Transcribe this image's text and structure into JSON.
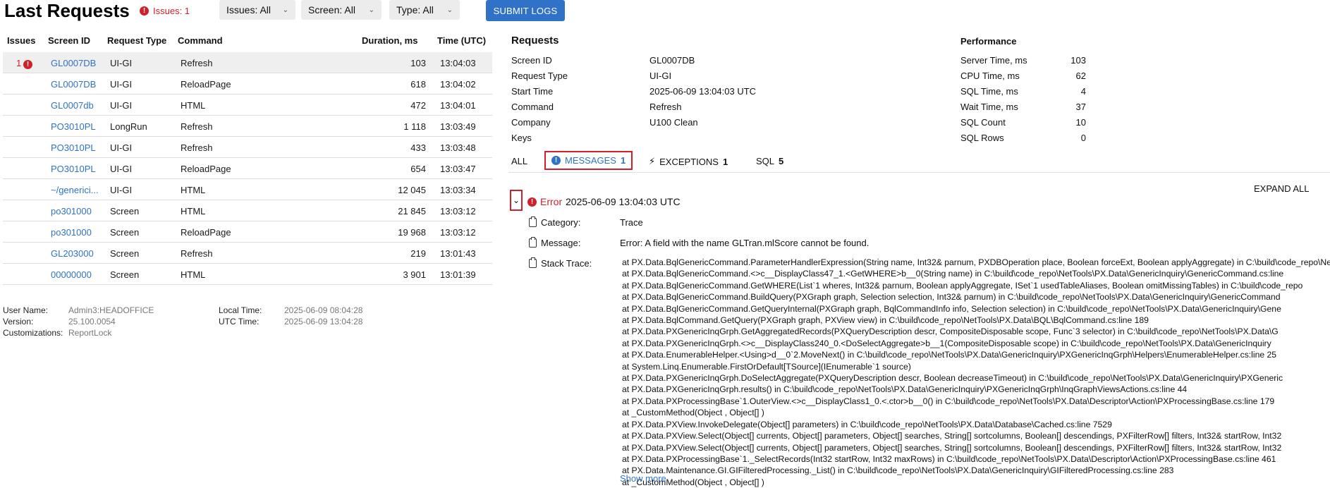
{
  "header": {
    "title": "Last Requests",
    "issues_label": "Issues: 1",
    "filters": [
      {
        "label": "Issues: All"
      },
      {
        "label": "Screen: All"
      },
      {
        "label": "Type: All"
      }
    ],
    "submit_label": "SUBMIT LOGS"
  },
  "table": {
    "columns": [
      "Issues",
      "Screen ID",
      "Request Type",
      "Command",
      "Duration, ms",
      "Time (UTC)"
    ],
    "rows": [
      {
        "issues": "1",
        "screen": "GL0007DB",
        "type": "UI-GI",
        "command": "Refresh",
        "duration": "103",
        "time": "13:04:03"
      },
      {
        "issues": "",
        "screen": "GL0007DB",
        "type": "UI-GI",
        "command": "ReloadPage",
        "duration": "618",
        "time": "13:04:02"
      },
      {
        "issues": "",
        "screen": "GL0007db",
        "type": "UI-GI",
        "command": "HTML",
        "duration": "472",
        "time": "13:04:01"
      },
      {
        "issues": "",
        "screen": "PO3010PL",
        "type": "LongRun",
        "command": "Refresh",
        "duration": "1 118",
        "time": "13:03:49"
      },
      {
        "issues": "",
        "screen": "PO3010PL",
        "type": "UI-GI",
        "command": "Refresh",
        "duration": "433",
        "time": "13:03:48"
      },
      {
        "issues": "",
        "screen": "PO3010PL",
        "type": "UI-GI",
        "command": "ReloadPage",
        "duration": "654",
        "time": "13:03:47"
      },
      {
        "issues": "",
        "screen": "~/generici...",
        "type": "UI-GI",
        "command": "HTML",
        "duration": "12 045",
        "time": "13:03:34"
      },
      {
        "issues": "",
        "screen": "po301000",
        "type": "Screen",
        "command": "HTML",
        "duration": "21 845",
        "time": "13:03:12"
      },
      {
        "issues": "",
        "screen": "po301000",
        "type": "Screen",
        "command": "ReloadPage",
        "duration": "19 968",
        "time": "13:03:12"
      },
      {
        "issues": "",
        "screen": "GL203000",
        "type": "Screen",
        "command": "Refresh",
        "duration": "219",
        "time": "13:01:43"
      },
      {
        "issues": "",
        "screen": "00000000",
        "type": "Screen",
        "command": "HTML",
        "duration": "3 901",
        "time": "13:01:39"
      }
    ]
  },
  "footer": {
    "user_name_label": "User Name:",
    "user_name": "Admin3:HEADOFFICE",
    "version_label": "Version:",
    "version": "25.100.0054",
    "customizations_label": "Customizations:",
    "customizations": "ReportLock",
    "local_time_label": "Local Time:",
    "local_time": "2025-06-09 08:04:28",
    "utc_time_label": "UTC Time:",
    "utc_time": "2025-06-09 13:04:28"
  },
  "requests": {
    "title": "Requests",
    "fields": [
      {
        "label": "Screen ID",
        "value": "GL0007DB"
      },
      {
        "label": "Request Type",
        "value": "UI-GI"
      },
      {
        "label": "Start Time",
        "value": "2025-06-09 13:04:03 UTC"
      },
      {
        "label": "Command",
        "value": "Refresh"
      },
      {
        "label": "Company",
        "value": "U100 Clean"
      },
      {
        "label": "Keys",
        "value": ""
      }
    ]
  },
  "performance": {
    "title": "Performance",
    "fields": [
      {
        "label": "Server Time, ms",
        "value": "103"
      },
      {
        "label": "CPU Time, ms",
        "value": "62"
      },
      {
        "label": "SQL Time, ms",
        "value": "4"
      },
      {
        "label": "Wait Time, ms",
        "value": "37"
      },
      {
        "label": "SQL Count",
        "value": "10"
      },
      {
        "label": "SQL Rows",
        "value": "0"
      }
    ]
  },
  "tabs": {
    "all": "ALL",
    "messages": "MESSAGES",
    "messages_count": "1",
    "exceptions": "EXCEPTIONS",
    "exceptions_count": "1",
    "sql": "SQL",
    "sql_count": "5"
  },
  "detail": {
    "expand_all": "EXPAND ALL",
    "error_label": "Error",
    "error_time": "2025-06-09 13:04:03 UTC",
    "category_label": "Category:",
    "category": "Trace",
    "message_label": "Message:",
    "message": "Error: A field with the name GLTran.mlScore cannot be found.",
    "stack_label": "Stack Trace:",
    "stack_lines": [
      "at PX.Data.BqlGenericCommand.ParameterHandlerExpression(String name, Int32& parnum, PXDBOperation place, Boolean forceExt, Boolean applyAggregate) in C:\\build\\code_repo\\NetTools\\PX.Data\\GenericInquiry\\GenericCommand.cs:line",
      "at PX.Data.BqlGenericCommand.<>c__DisplayClass47_1.<GetWHERE>b__0(String name) in C:\\build\\code_repo\\NetTools\\PX.Data\\GenericInquiry\\GenericCommand.cs:line",
      "at PX.Data.BqlGenericCommand.GetWHERE(List`1 wheres, Int32& parnum, Boolean applyAggregate, ISet`1 usedTableAliases, Boolean omitMissingTables) in C:\\build\\code_repo",
      "at PX.Data.BqlGenericCommand.BuildQuery(PXGraph graph, Selection selection, Int32& parnum) in C:\\build\\code_repo\\NetTools\\PX.Data\\GenericInquiry\\GenericCommand",
      "at PX.Data.BqlGenericCommand.GetQueryInternal(PXGraph graph, BqlCommandInfo info, Selection selection) in C:\\build\\code_repo\\NetTools\\PX.Data\\GenericInquiry\\Gene",
      "at PX.Data.BqlCommand.GetQuery(PXGraph graph, PXView view) in C:\\build\\code_repo\\NetTools\\PX.Data\\BQL\\BqlCommand.cs:line 189",
      "at PX.Data.PXGenericInqGrph.GetAggregatedRecords(PXQueryDescription descr, CompositeDisposable scope, Func`3 selector) in C:\\build\\code_repo\\NetTools\\PX.Data\\G",
      "at PX.Data.PXGenericInqGrph.<>c__DisplayClass240_0.<DoSelectAggregate>b__1(CompositeDisposable scope) in C:\\build\\code_repo\\NetTools\\PX.Data\\GenericInquiry",
      "at PX.Data.EnumerableHelper.<Using>d__0`2.MoveNext() in C:\\build\\code_repo\\NetTools\\PX.Data\\GenericInquiry\\PXGenericInqGrph\\Helpers\\EnumerableHelper.cs:line 25",
      "at System.Linq.Enumerable.FirstOrDefault[TSource](IEnumerable`1 source)",
      "at PX.Data.PXGenericInqGrph.DoSelectAggregate(PXQueryDescription descr, Boolean decreaseTimeout) in C:\\build\\code_repo\\NetTools\\PX.Data\\GenericInquiry\\PXGeneric",
      "at PX.Data.PXGenericInqGrph.results() in C:\\build\\code_repo\\NetTools\\PX.Data\\GenericInquiry\\PXGenericInqGrph\\InqGraphViewsActions.cs:line 44",
      "at PX.Data.PXProcessingBase`1.OuterView.<>c__DisplayClass1_0.<.ctor>b__0() in C:\\build\\code_repo\\NetTools\\PX.Data\\Descriptor\\Action\\PXProcessingBase.cs:line 179",
      "at _CustomMethod(Object , Object[] )",
      "at PX.Data.PXView.InvokeDelegate(Object[] parameters) in C:\\build\\code_repo\\NetTools\\PX.Data\\Database\\Cached.cs:line 7529",
      "at PX.Data.PXView.Select(Object[] currents, Object[] parameters, Object[] searches, String[] sortcolumns, Boolean[] descendings, PXFilterRow[] filters, Int32& startRow, Int32",
      "at PX.Data.PXView.Select(Object[] currents, Object[] parameters, Object[] searches, String[] sortcolumns, Boolean[] descendings, PXFilterRow[] filters, Int32& startRow, Int32",
      "at PX.Data.PXProcessingBase`1._SelectRecords(Int32 startRow, Int32 maxRows) in C:\\build\\code_repo\\NetTools\\PX.Data\\Descriptor\\Action\\PXProcessingBase.cs:line 461",
      "at PX.Data.Maintenance.GI.GIFilteredProcessing._List() in C:\\build\\code_repo\\NetTools\\PX.Data\\GenericInquiry\\GIFilteredProcessing.cs:line 283",
      "at _CustomMethod(Object , Object[] )"
    ],
    "show_more": "Show more"
  },
  "colors": {
    "accent": "#2f72c8",
    "error": "#d0212b"
  }
}
